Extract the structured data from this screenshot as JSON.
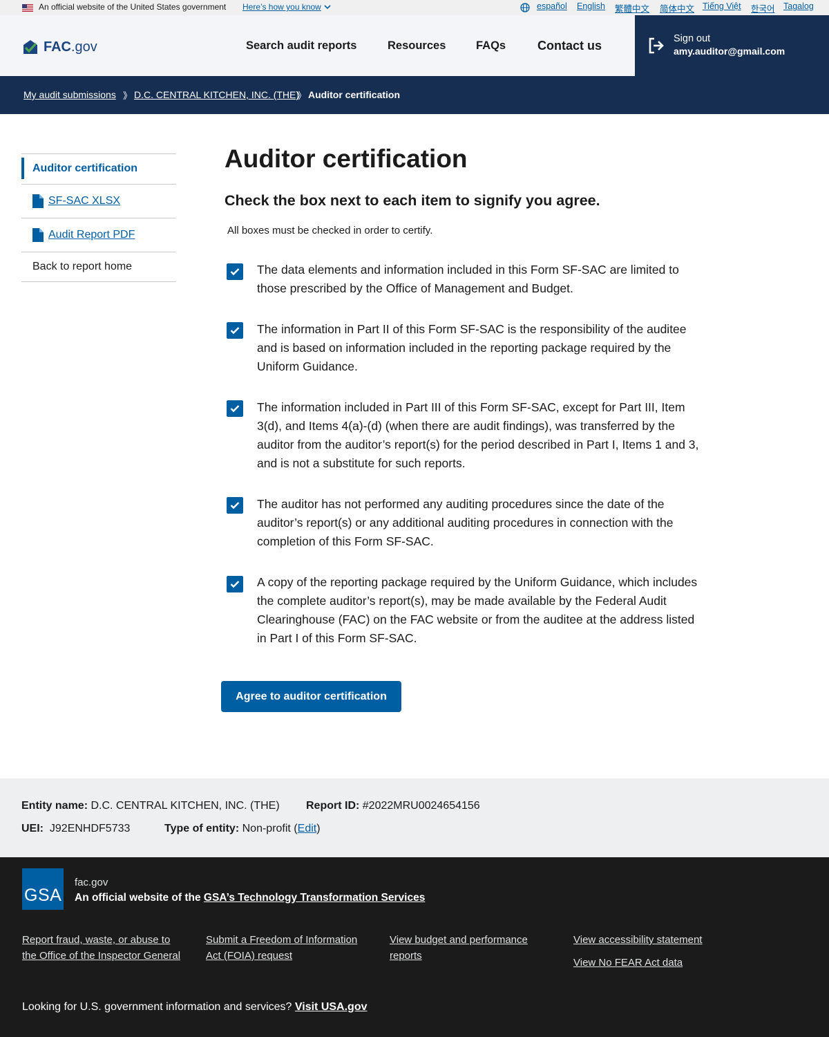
{
  "banner": {
    "official_text": "An official website of the United States government",
    "how_you_know": "Here’s how you know",
    "languages": [
      "español",
      "English",
      "繁體中文",
      "简体中文",
      "Tiếng Việt",
      "한국어",
      "Tagalog"
    ]
  },
  "header": {
    "logo_bold": "FAC",
    "logo_rest": ".gov",
    "nav": [
      "Search audit reports",
      "Resources",
      "FAQs",
      "Contact us"
    ],
    "signout_label": "Sign out",
    "user_email": "amy.auditor@gmail.com"
  },
  "breadcrumb": {
    "items": [
      "My audit submissions",
      "D.C. CENTRAL KITCHEN, INC. (THE)"
    ],
    "current": "Auditor certification",
    "separator": "》"
  },
  "sidenav": {
    "active": "Auditor certification",
    "links": [
      "SF-SAC XLSX",
      "Audit Report PDF"
    ],
    "back": "Back to report home"
  },
  "main": {
    "title": "Auditor certification",
    "subtitle": "Check the box next to each item to signify you agree.",
    "hint": "All boxes must be checked in order to certify.",
    "items": [
      {
        "text": "The data elements and information included in this Form SF-SAC are limited to those prescribed by the Office of Management and Budget.",
        "checked": true
      },
      {
        "text": "The information in Part II of this Form SF-SAC is the responsibility of the auditee and is based on information included in the reporting package required by the Uniform Guidance.",
        "checked": true
      },
      {
        "text": "The information included in Part III of this Form SF-SAC, except for Part III, Item 3(d), and Items 4(a)-(d) (when there are audit findings), was transferred by the auditor from the auditor’s report(s) for the period described in Part I, Items 1 and 3, and is not a substitute for such reports.",
        "checked": true
      },
      {
        "text": "The auditor has not performed any auditing procedures since the date of the auditor’s report(s) or any additional auditing procedures in connection with the completion of this Form SF-SAC.",
        "checked": true
      },
      {
        "text": "A copy of the reporting package required by the Uniform Guidance, which includes the complete auditor’s report(s), may be made available by the Federal Audit Clearinghouse (FAC) on the FAC website or from the auditee at the address listed in Part I of this Form SF-SAC.",
        "checked": true
      }
    ],
    "button": "Agree to auditor certification"
  },
  "info": {
    "entity_label": "Entity name:",
    "entity_value": "D.C. CENTRAL KITCHEN, INC. (THE)",
    "report_label": "Report ID:",
    "report_value": "#2022MRU0024654156",
    "uei_label": "UEI:",
    "uei_value": "J92ENHDF5733",
    "type_label": "Type of entity:",
    "type_value": "Non-profit",
    "edit": "Edit"
  },
  "footer": {
    "gsa_logo": "GSA",
    "site": "fac.gov",
    "official_prefix": "An official website of the",
    "official_link": "GSA’s Technology Transformation Services",
    "links": [
      "Report fraud, waste, or abuse to the Office of the Inspector General",
      "Submit a Freedom of Information Act (FOIA) request",
      "View budget and performance reports",
      "View accessibility statement",
      "View No FEAR Act data"
    ],
    "usa_text": "Looking for U.S. government information and services?",
    "usa_link": "Visit USA.gov"
  },
  "colors": {
    "primary": "#005ea2",
    "navy": "#162e51",
    "logo_blue": "#1a4480",
    "logo_green": "#4fa34c",
    "footer_bg": "#1b1b1b",
    "infobar_bg": "#edeff0"
  }
}
